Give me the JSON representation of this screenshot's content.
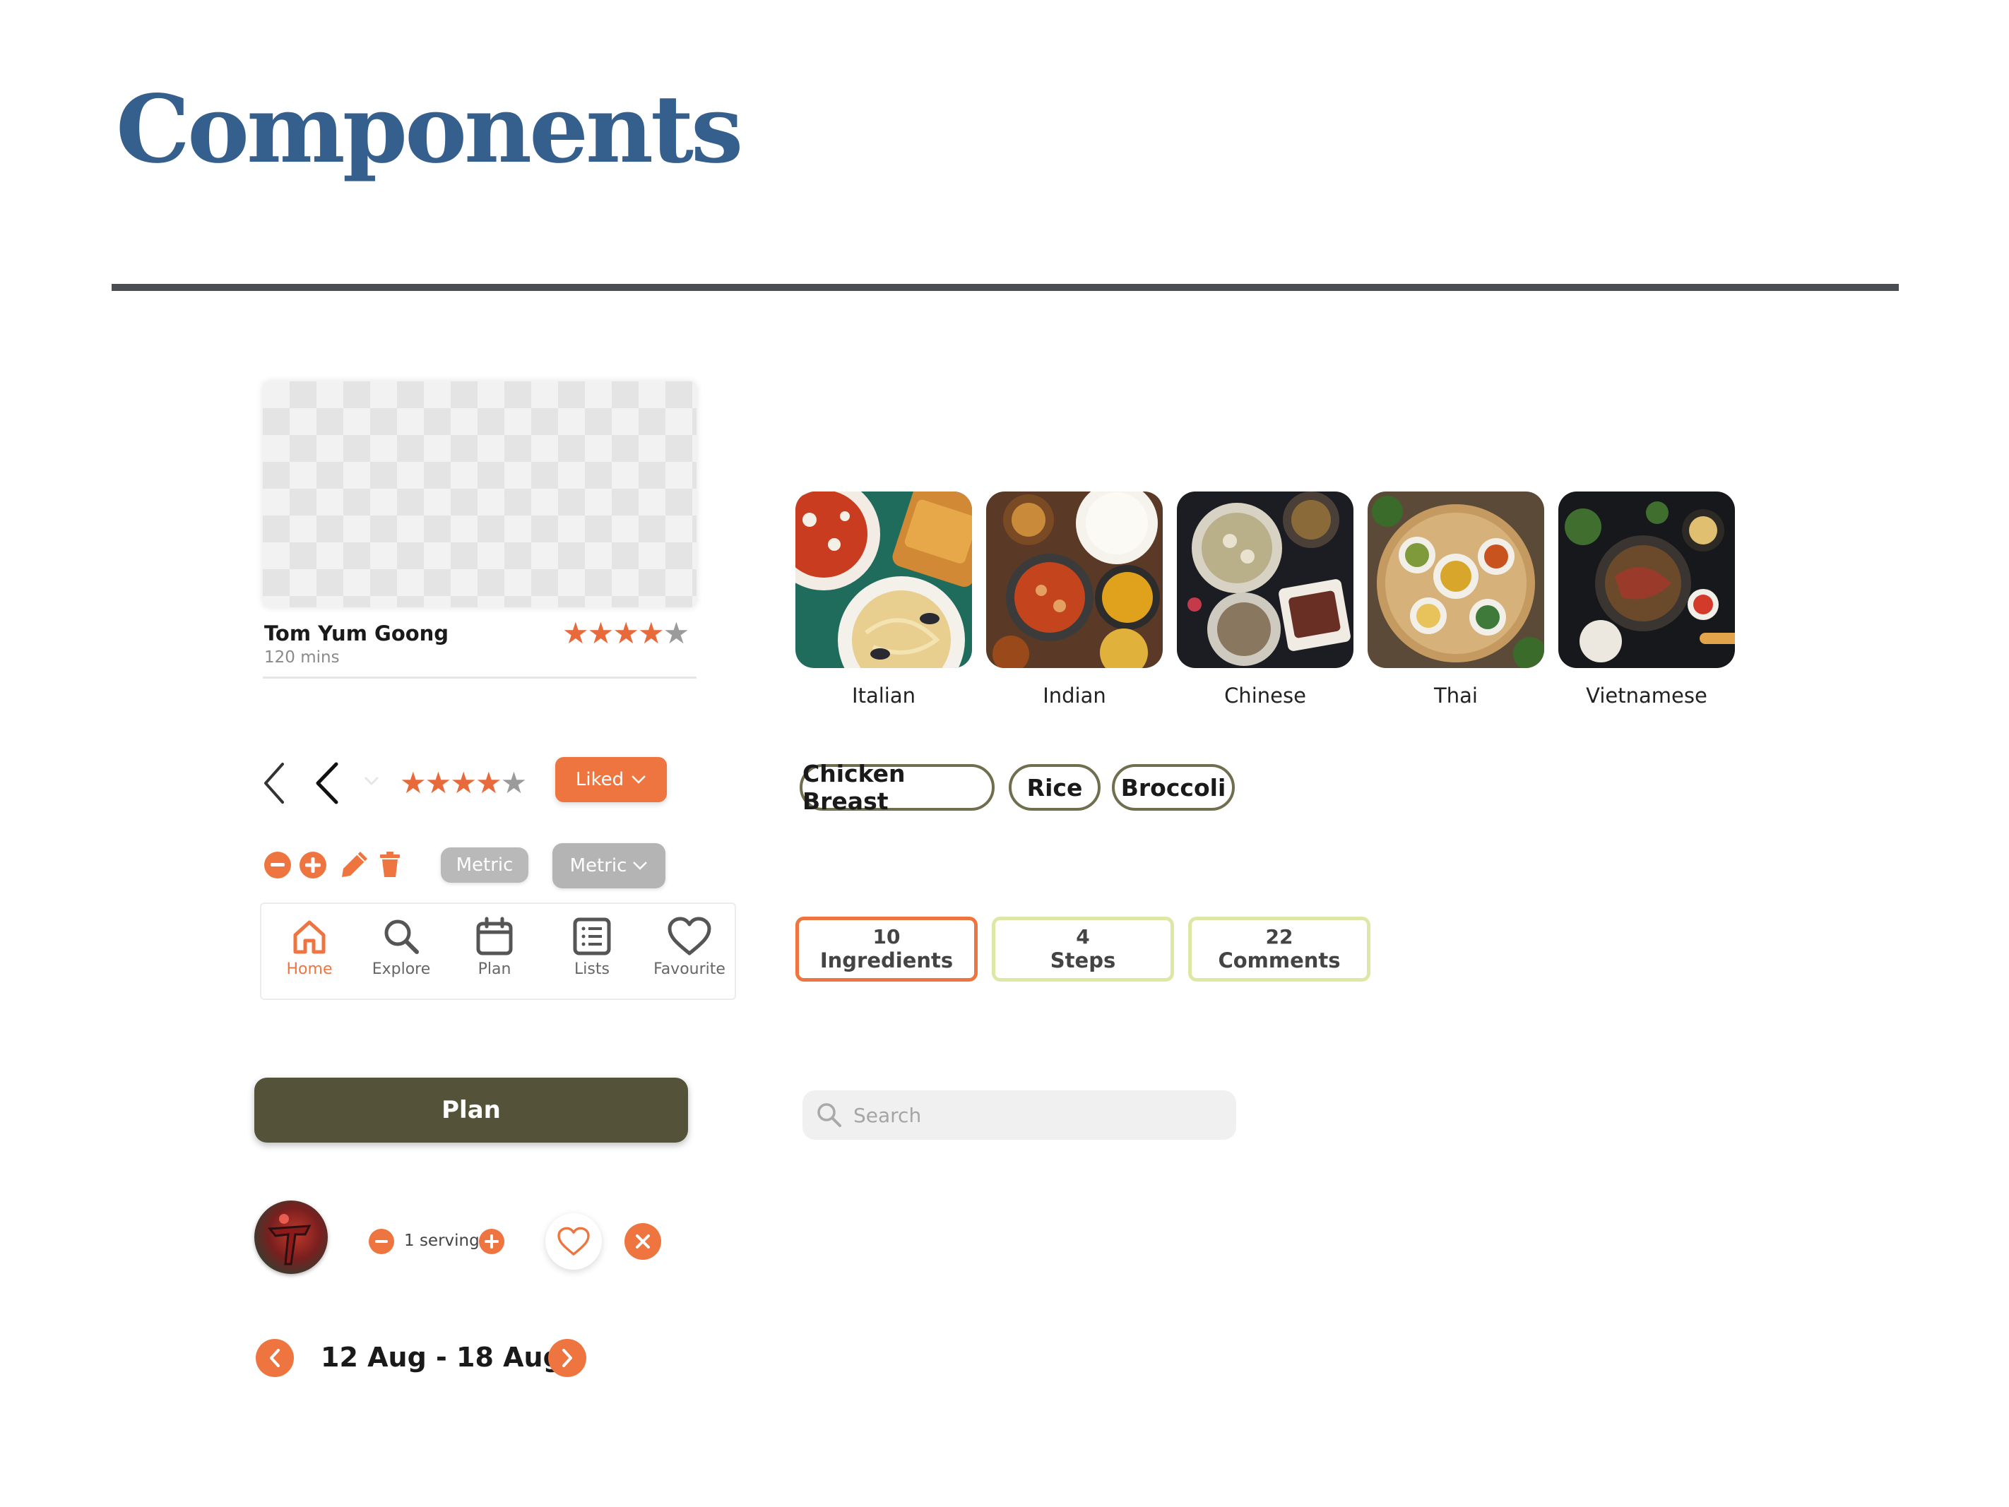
{
  "page": {
    "title": "Components"
  },
  "recipe_card": {
    "title": "Tom Yum Goong",
    "time": "120 mins",
    "rating": 4,
    "max_rating": 5
  },
  "controls": {
    "liked_label": "Liked",
    "rating": 4,
    "max_rating": 5,
    "metric_label": "Metric",
    "metric_dropdown_label": "Metric"
  },
  "bottom_nav": {
    "items": [
      {
        "label": "Home",
        "icon": "home-icon",
        "active": true
      },
      {
        "label": "Explore",
        "icon": "search-icon",
        "active": false
      },
      {
        "label": "Plan",
        "icon": "calendar-icon",
        "active": false
      },
      {
        "label": "Lists",
        "icon": "list-icon",
        "active": false
      },
      {
        "label": "Favourite",
        "icon": "heart-icon",
        "active": false
      }
    ]
  },
  "plan_button": {
    "label": "Plan"
  },
  "serving": {
    "label": "1 serving"
  },
  "week": {
    "label": "12 Aug - 18 Aug"
  },
  "cuisines": [
    {
      "label": "Italian"
    },
    {
      "label": "Indian"
    },
    {
      "label": "Chinese"
    },
    {
      "label": "Thai"
    },
    {
      "label": "Vietnamese"
    }
  ],
  "ingredients": [
    {
      "label": "Chicken Breast"
    },
    {
      "label": "Rice"
    },
    {
      "label": "Broccoli"
    }
  ],
  "stats": [
    {
      "value": "10",
      "label": "Ingredients",
      "active": true
    },
    {
      "value": "4",
      "label": "Steps",
      "active": false
    },
    {
      "value": "22",
      "label": "Comments",
      "active": false
    }
  ],
  "search": {
    "placeholder": "Search"
  },
  "colors": {
    "accent": "#ee7440",
    "title_blue": "#355f8d",
    "olive": "#545339",
    "chip_border": "#6f6e4e",
    "stat_border": "#dde8a7"
  }
}
